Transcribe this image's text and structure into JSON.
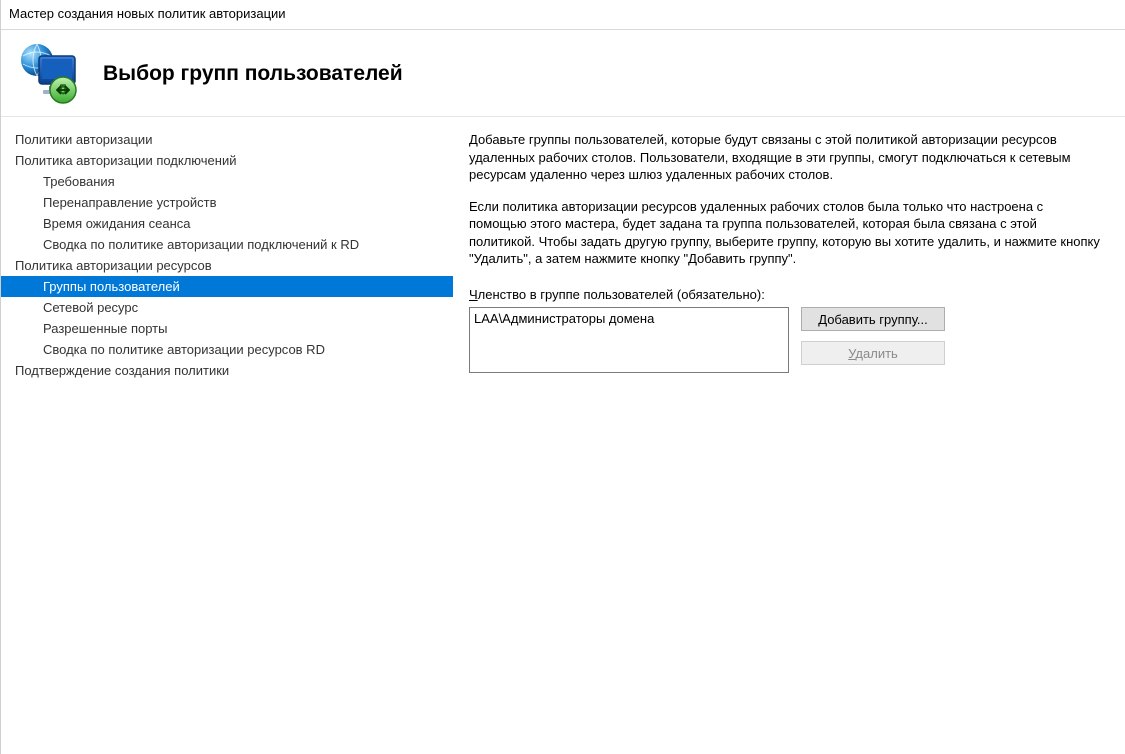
{
  "window": {
    "title": "Мастер создания новых политик авторизации"
  },
  "header": {
    "title": "Выбор групп пользователей"
  },
  "nav": {
    "items": [
      {
        "label": "Политики авторизации",
        "indent": 0,
        "selected": false
      },
      {
        "label": "Политика авторизации подключений",
        "indent": 0,
        "selected": false
      },
      {
        "label": "Требования",
        "indent": 1,
        "selected": false
      },
      {
        "label": "Перенаправление устройств",
        "indent": 1,
        "selected": false
      },
      {
        "label": "Время ожидания сеанса",
        "indent": 1,
        "selected": false
      },
      {
        "label": "Сводка по политике авторизации подключений к RD",
        "indent": 1,
        "selected": false
      },
      {
        "label": "Политика авторизации ресурсов",
        "indent": 0,
        "selected": false
      },
      {
        "label": "Группы пользователей",
        "indent": 1,
        "selected": true
      },
      {
        "label": "Сетевой ресурс",
        "indent": 1,
        "selected": false
      },
      {
        "label": "Разрешенные порты",
        "indent": 1,
        "selected": false
      },
      {
        "label": "Сводка по политике авторизации ресурсов RD",
        "indent": 1,
        "selected": false
      },
      {
        "label": "Подтверждение создания политики",
        "indent": 0,
        "selected": false
      }
    ]
  },
  "content": {
    "para1": "Добавьте группы пользователей, которые будут связаны с этой политикой авторизации ресурсов удаленных рабочих столов. Пользователи, входящие в эти группы, смогут подключаться к сетевым ресурсам удаленно через шлюз удаленных рабочих столов.",
    "para2": "Если политика авторизации ресурсов удаленных рабочих столов была только что настроена с помощью этого мастера, будет задана та группа пользователей, которая была связана с этой политикой. Чтобы задать другую группу, выберите группу, которую вы хотите удалить, и нажмите кнопку \"Удалить\", а затем нажмите кнопку \"Добавить группу\".",
    "membership_label_pre": "Ч",
    "membership_label_rest": "ленство в группе пользователей (обязательно):",
    "groups": [
      "LAA\\Администраторы домена"
    ],
    "add_button_pre": "Д",
    "add_button_rest": "обавить группу...",
    "delete_button_pre": "У",
    "delete_button_rest": "далить",
    "delete_disabled": true
  }
}
